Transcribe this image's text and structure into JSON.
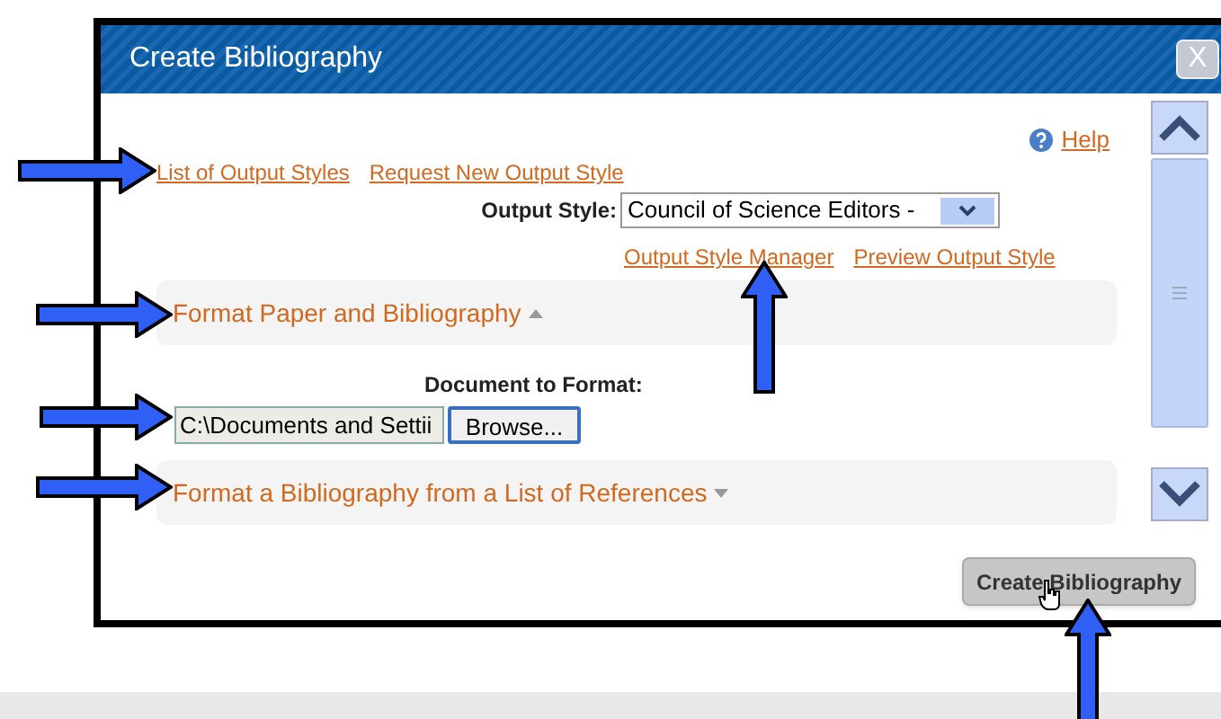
{
  "window": {
    "title": "Create Bibliography",
    "close": "X"
  },
  "help": "Help",
  "top_links": [
    "List of Output Styles",
    "Request New Output Style"
  ],
  "output_style": {
    "label": "Output Style:",
    "value": "Council of Science Editors - "
  },
  "style_links": [
    "Output Style Manager",
    "Preview Output Style"
  ],
  "sections": [
    {
      "label": "Format Paper and Bibliography",
      "expanded": true
    },
    {
      "label": "Format a Bibliography from a List of References",
      "expanded": false
    }
  ],
  "document": {
    "label": "Document to Format:",
    "value": "C:\\Documents and Settii",
    "browse": "Browse..."
  },
  "create_button": "Create Bibliography"
}
